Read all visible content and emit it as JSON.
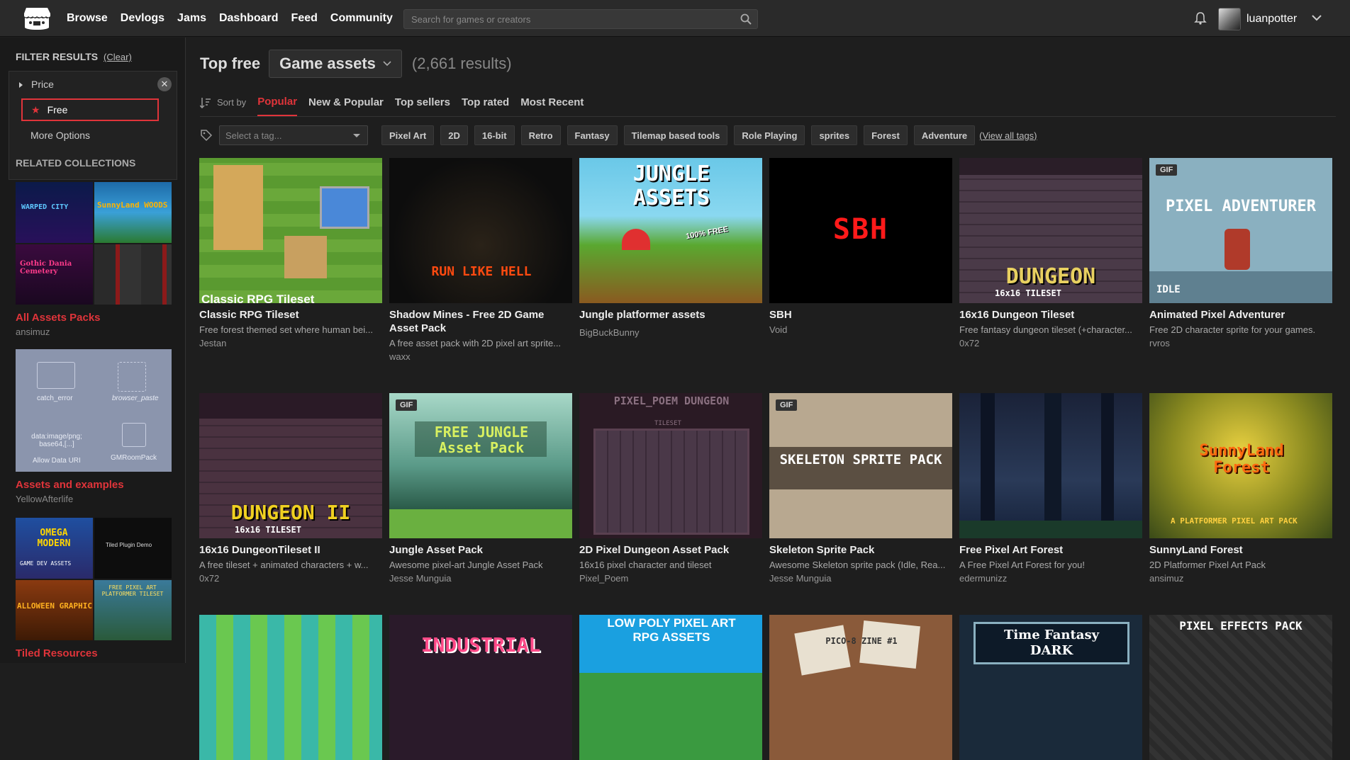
{
  "nav": {
    "items": [
      "Browse",
      "Devlogs",
      "Jams",
      "Dashboard",
      "Feed",
      "Community"
    ],
    "search_placeholder": "Search for games or creators",
    "username": "luanpotter"
  },
  "sidebar": {
    "filter_title": "FILTER RESULTS",
    "clear_label": "(Clear)",
    "price_label": "Price",
    "free_label": "Free",
    "more_options": "More Options",
    "related_title": "RELATED COLLECTIONS",
    "collections": [
      {
        "name": "All Assets Packs",
        "user": "ansimuz"
      },
      {
        "name": "Assets and examples",
        "user": "YellowAfterlife"
      },
      {
        "name": "Tiled Resources",
        "user": ""
      }
    ],
    "coll2_labels": [
      "catch_error",
      "browser_paste",
      "data:image/png; base64,[...]",
      "Allow Data URI",
      "GMRoomPack"
    ],
    "coll1_texts": [
      "WARPED CITY",
      "SunnyLand WOODS",
      "Gothic Dania Cemetery"
    ],
    "coll3_texts": [
      "OMEGA MODERN",
      "GAME DEV ASSETS",
      "Tiled Plugin Demo",
      "ALLOWEEN GRAPHIC",
      "FREE PIXEL ART PLATFORMER TILESET"
    ]
  },
  "main": {
    "heading_prefix": "Top free",
    "category": "Game assets",
    "results": "(2,661 results)",
    "sort_label": "Sort by",
    "sort_tabs": [
      "Popular",
      "New & Popular",
      "Top sellers",
      "Top rated",
      "Most Recent"
    ],
    "tag_placeholder": "Select a tag...",
    "tags": [
      "Pixel Art",
      "2D",
      "16-bit",
      "Retro",
      "Fantasy",
      "Tilemap based tools",
      "Role Playing",
      "sprites",
      "Forest",
      "Adventure"
    ],
    "view_all": "(View all tags)"
  },
  "games": [
    {
      "title": "Classic RPG Tileset",
      "desc": "Free forest themed set where human bei...",
      "author": "Jestan",
      "thumb_text": "Classic RPG Tileset",
      "gif": false
    },
    {
      "title": "Shadow Mines - Free 2D Game Asset Pack",
      "desc": "A free asset pack with 2D pixel art sprite...",
      "author": "waxx",
      "thumb_text": "RUN LIKE HELL",
      "gif": false
    },
    {
      "title": "Jungle platformer assets",
      "desc": "",
      "author": "BigBuckBunny",
      "thumb_text": "JUNGLE ASSETS",
      "gif": false
    },
    {
      "title": "SBH",
      "desc": "",
      "author": "Void",
      "thumb_text": "SBH",
      "gif": false
    },
    {
      "title": "16x16 Dungeon Tileset",
      "desc": "Free fantasy dungeon tileset (+character...",
      "author": "0x72",
      "thumb_text": "DUNGEON",
      "gif": false
    },
    {
      "title": "Animated Pixel Adventurer",
      "desc": "Free 2D character sprite for your games.",
      "author": "rvros",
      "thumb_text": "PIXEL ADVENTURER",
      "gif": true
    },
    {
      "title": "16x16 DungeonTileset II",
      "desc": "A free tileset + animated characters + w...",
      "author": "0x72",
      "thumb_text": "DUNGEON II",
      "gif": false
    },
    {
      "title": "Jungle Asset Pack",
      "desc": "Awesome pixel-art Jungle Asset Pack",
      "author": "Jesse Munguia",
      "thumb_text": "FREE JUNGLE Asset Pack",
      "gif": true
    },
    {
      "title": "2D Pixel Dungeon Asset Pack",
      "desc": "16x16 pixel character and tileset",
      "author": "Pixel_Poem",
      "thumb_text": "PIXEL_POEM DUNGEON",
      "gif": false
    },
    {
      "title": "Skeleton Sprite Pack",
      "desc": "Awesome Skeleton sprite pack (Idle, Rea...",
      "author": "Jesse Munguia",
      "thumb_text": "SKELETON SPRITE PACK",
      "gif": true
    },
    {
      "title": "Free Pixel Art Forest",
      "desc": "A Free Pixel Art Forest for you!",
      "author": "edermunizz",
      "thumb_text": "",
      "gif": false
    },
    {
      "title": "SunnyLand Forest",
      "desc": "2D Platformer Pixel Art Pack",
      "author": "ansimuz",
      "thumb_text": "SunnyLand Forest",
      "gif": false
    }
  ],
  "row3_texts": [
    "",
    "INDUSTRIAL",
    "LOW POLY PIXEL ART RPG ASSETS",
    "PICO-8 ZINE #1",
    "Time Fantasy DARK",
    "PIXEL EFFECTS PACK"
  ],
  "extra_texts": {
    "jungle_badge": "100% FREE",
    "adventurer_state": "IDLE",
    "dungeon_sub": "16x16 TILESET",
    "pixel_poem_sub": "TILESET",
    "sunnyland_sub": "A PLATFORMER PIXEL ART PACK"
  }
}
